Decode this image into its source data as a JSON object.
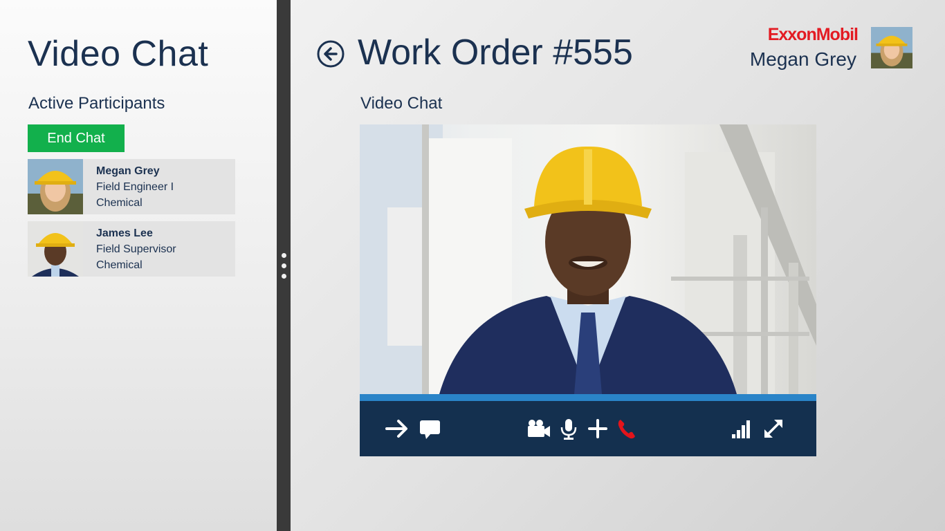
{
  "left": {
    "title": "Video Chat",
    "section_label": "Active Participants",
    "end_chat_label": "End Chat",
    "participants": [
      {
        "name": "Megan Grey",
        "role": "Field Engineer I",
        "dept": "Chemical"
      },
      {
        "name": "James Lee",
        "role": "Field Supervisor",
        "dept": "Chemical"
      }
    ]
  },
  "header": {
    "title": "Work Order #555",
    "logo_text": "ExxonMobil",
    "user_name": "Megan Grey"
  },
  "main": {
    "section_label": "Video Chat"
  },
  "icons": {
    "back": "back-arrow-circle-icon",
    "forward": "arrow-right-icon",
    "chat": "speech-bubble-icon",
    "camera": "video-camera-icon",
    "mic": "microphone-icon",
    "add": "plus-icon",
    "hangup": "phone-hangup-icon",
    "signal": "signal-bars-icon",
    "fullscreen": "expand-icon"
  },
  "colors": {
    "accent_green": "#12b04c",
    "nav_dark": "#14304f",
    "progress_blue": "#2a84c8",
    "hangup_red": "#e3141b",
    "brand_red": "#e31b23"
  }
}
